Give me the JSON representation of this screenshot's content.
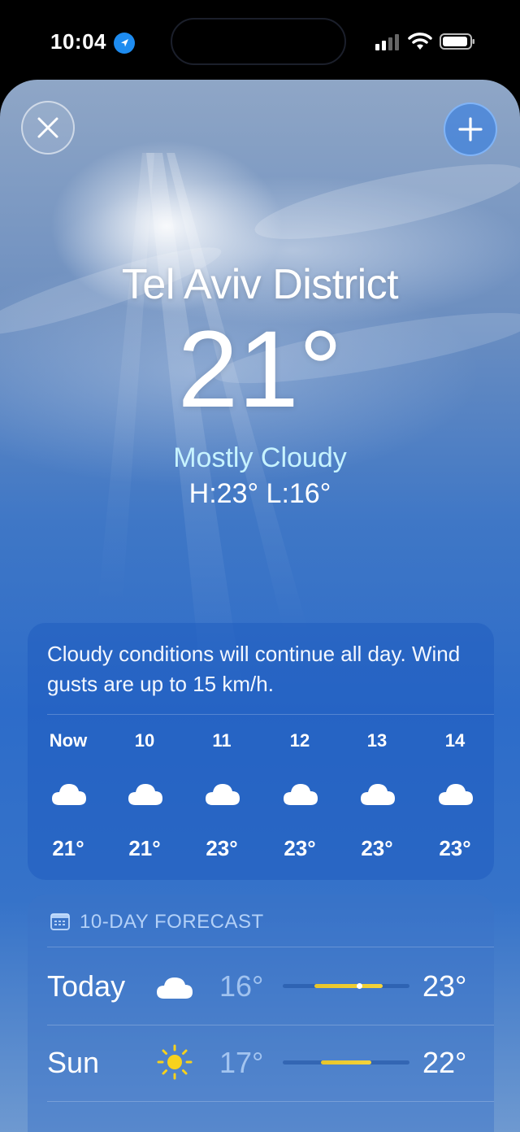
{
  "status_bar": {
    "time": "10:04",
    "icons": [
      "location-arrow-icon",
      "cellular-signal-icon",
      "wifi-icon",
      "battery-icon"
    ]
  },
  "top_buttons": {
    "close_icon": "close-icon",
    "add_icon": "plus-icon"
  },
  "location": {
    "city": "Tel Aviv District",
    "temperature": "21°",
    "condition": "Mostly Cloudy",
    "high_low": "H:23°  L:16°"
  },
  "hourly": {
    "summary": "Cloudy conditions will continue all day. Wind gusts are up to 15 km/h.",
    "hours": [
      {
        "label": "Now",
        "icon": "cloud-icon",
        "temp": "21°"
      },
      {
        "label": "10",
        "icon": "cloud-icon",
        "temp": "21°"
      },
      {
        "label": "11",
        "icon": "cloud-icon",
        "temp": "23°"
      },
      {
        "label": "12",
        "icon": "cloud-icon",
        "temp": "23°"
      },
      {
        "label": "13",
        "icon": "cloud-icon",
        "temp": "23°"
      },
      {
        "label": "14",
        "icon": "cloud-icon",
        "temp": "23°"
      }
    ]
  },
  "forecast": {
    "title": "10-DAY FORECAST",
    "icon": "calendar-icon",
    "days": [
      {
        "day": "Today",
        "icon": "cloud-icon",
        "low": "16°",
        "high": "23°",
        "range_start": 0.25,
        "range_end": 0.79,
        "current_marker": 0.6
      },
      {
        "day": "Sun",
        "icon": "sun-icon",
        "low": "17°",
        "high": "22°",
        "range_start": 0.3,
        "range_end": 0.7
      }
    ]
  },
  "colors": {
    "condition_text": "#c7f3ff",
    "range_bar": "#f4d33a",
    "location_arrow": "#1e8cf0"
  }
}
